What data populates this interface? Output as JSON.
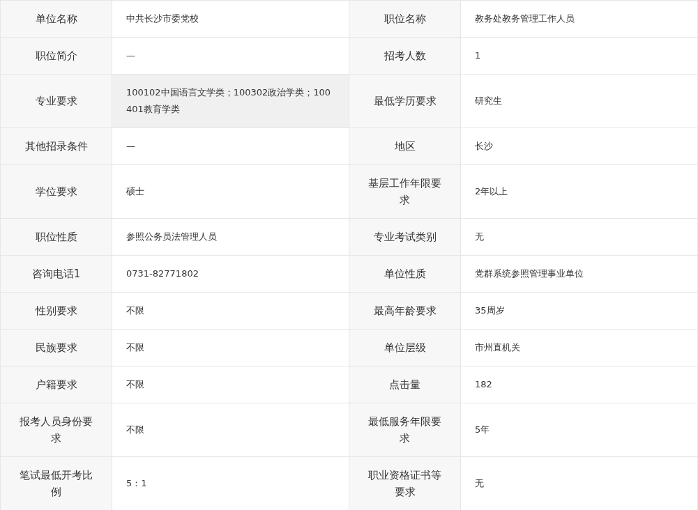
{
  "rows": [
    {
      "fields": [
        {
          "label": "单位名称",
          "value": "中共长沙市委党校",
          "shaded": false
        },
        {
          "label": "职位名称",
          "value": "教务处教务管理工作人员",
          "shaded": false
        }
      ]
    },
    {
      "fields": [
        {
          "label": "职位简介",
          "value": "—",
          "shaded": false
        },
        {
          "label": "招考人数",
          "value": "1",
          "shaded": false
        }
      ]
    },
    {
      "fields": [
        {
          "label": "专业要求",
          "value": "100102中国语言文学类；100302政治学类；100401教育学类",
          "shaded": true
        },
        {
          "label": "最低学历要求",
          "value": "研究生",
          "shaded": false
        }
      ]
    },
    {
      "fields": [
        {
          "label": "其他招录条件",
          "value": "—",
          "shaded": false
        },
        {
          "label": "地区",
          "value": "长沙",
          "shaded": false
        }
      ]
    },
    {
      "fields": [
        {
          "label": "学位要求",
          "value": "硕士",
          "shaded": false
        },
        {
          "label": "基层工作年限要求",
          "value": "2年以上",
          "shaded": false
        }
      ]
    },
    {
      "fields": [
        {
          "label": "职位性质",
          "value": "参照公务员法管理人员",
          "shaded": false
        },
        {
          "label": "专业考试类别",
          "value": "无",
          "shaded": false
        }
      ]
    },
    {
      "fields": [
        {
          "label": "咨询电话1",
          "value": "0731-82771802",
          "shaded": false
        },
        {
          "label": "单位性质",
          "value": "党群系统参照管理事业单位",
          "shaded": false
        }
      ]
    },
    {
      "fields": [
        {
          "label": "性别要求",
          "value": "不限",
          "shaded": false
        },
        {
          "label": "最高年龄要求",
          "value": "35周岁",
          "shaded": false
        }
      ]
    },
    {
      "fields": [
        {
          "label": "民族要求",
          "value": "不限",
          "shaded": false
        },
        {
          "label": "单位层级",
          "value": "市州直机关",
          "shaded": false
        }
      ]
    },
    {
      "fields": [
        {
          "label": "户籍要求",
          "value": "不限",
          "shaded": false
        },
        {
          "label": "点击量",
          "value": "182",
          "shaded": false
        }
      ]
    },
    {
      "fields": [
        {
          "label": "报考人员身份要求",
          "value": "不限",
          "shaded": false
        },
        {
          "label": "最低服务年限要求",
          "value": "5年",
          "shaded": false
        }
      ]
    },
    {
      "fields": [
        {
          "label": "笔试最低开考比例",
          "value": "5：1",
          "shaded": false
        },
        {
          "label": "职业资格证书等要求",
          "value": "无",
          "shaded": false
        }
      ]
    }
  ]
}
